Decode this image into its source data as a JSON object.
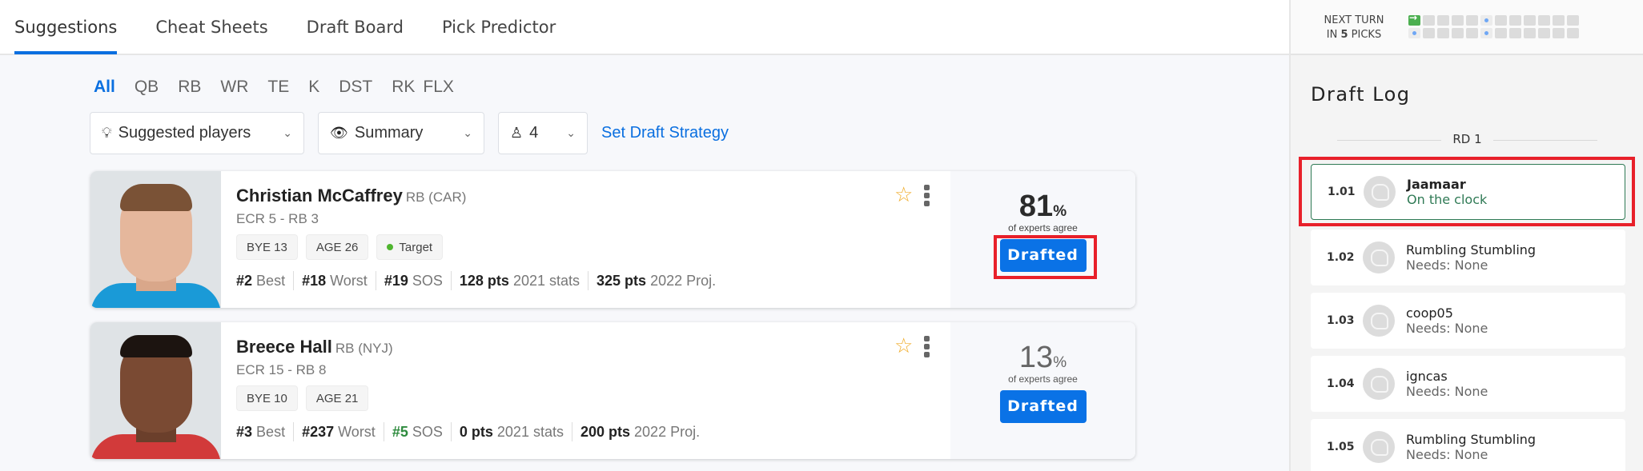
{
  "tabs": [
    {
      "label": "Suggestions",
      "active": true
    },
    {
      "label": "Cheat Sheets",
      "active": false
    },
    {
      "label": "Draft Board",
      "active": false
    },
    {
      "label": "Pick Predictor",
      "active": false
    }
  ],
  "positions": [
    "All",
    "QB",
    "RB",
    "WR",
    "TE",
    "K",
    "DST",
    "RK",
    "FLX"
  ],
  "positions_active": "All",
  "filters": {
    "view": {
      "icon": "lightbulb-icon",
      "value": "Suggested players"
    },
    "display": {
      "icon": "eye-icon",
      "value": "Summary"
    },
    "count": {
      "icon": "user-icon",
      "value": "4"
    },
    "strategy_link": "Set Draft Strategy"
  },
  "players": [
    {
      "name": "Christian McCaffrey",
      "pos_team": "RB (CAR)",
      "ecr": "ECR 5 - RB 3",
      "badges": [
        "BYE 13",
        "AGE 26"
      ],
      "target": "Target",
      "stats": [
        {
          "value": "#2",
          "label": "Best"
        },
        {
          "value": "#18",
          "label": "Worst"
        },
        {
          "value": "#19",
          "label": "SOS"
        },
        {
          "value": "128 pts",
          "label": "2021 stats"
        },
        {
          "value": "325 pts",
          "label": "2022 Proj."
        }
      ],
      "agree_pct": "81",
      "agree_unit": "%",
      "agree_label": "of experts agree",
      "button": "Drafted"
    },
    {
      "name": "Breece Hall",
      "pos_team": "RB (NYJ)",
      "ecr": "ECR 15 - RB 8",
      "badges": [
        "BYE 10",
        "AGE 21"
      ],
      "stats": [
        {
          "value": "#3",
          "label": "Best"
        },
        {
          "value": "#237",
          "label": "Worst"
        },
        {
          "value": "#5",
          "label": "SOS"
        },
        {
          "value": "0 pts",
          "label": "2021 stats"
        },
        {
          "value": "200 pts",
          "label": "2022 Proj."
        }
      ],
      "agree_pct": "13",
      "agree_unit": "%",
      "agree_label": "of experts agree",
      "button": "Drafted"
    }
  ],
  "next_turn": {
    "line1": "NEXT TURN",
    "line2_prefix": "IN",
    "picks": "5",
    "line2_suffix": "PICKS"
  },
  "pick_grid": {
    "rows": [
      [
        "current",
        "empty",
        "empty",
        "empty",
        "empty",
        "mine",
        "empty",
        "empty",
        "empty",
        "empty",
        "empty",
        "empty"
      ],
      [
        "mine",
        "empty",
        "empty",
        "empty",
        "empty",
        "mine",
        "empty",
        "empty",
        "empty",
        "empty",
        "empty",
        "empty"
      ]
    ]
  },
  "draft_log": {
    "title": "Draft Log",
    "round": "RD 1",
    "picks": [
      {
        "num": "1.01",
        "team": "Jaamaar",
        "status": "On the clock",
        "on_clock": true
      },
      {
        "num": "1.02",
        "team": "Rumbling Stumbling",
        "status": "Needs: None"
      },
      {
        "num": "1.03",
        "team": "coop05",
        "status": "Needs: None"
      },
      {
        "num": "1.04",
        "team": "igncas",
        "status": "Needs: None"
      },
      {
        "num": "1.05",
        "team": "Rumbling Stumbling",
        "status": "Needs: None"
      }
    ]
  },
  "colors": {
    "accent": "#0a6fe0",
    "button": "#0a72e6",
    "on_clock": "#2f7a55",
    "highlight": "#e8202a",
    "star": "#f0ad2b",
    "target_dot": "#4fb52f"
  }
}
